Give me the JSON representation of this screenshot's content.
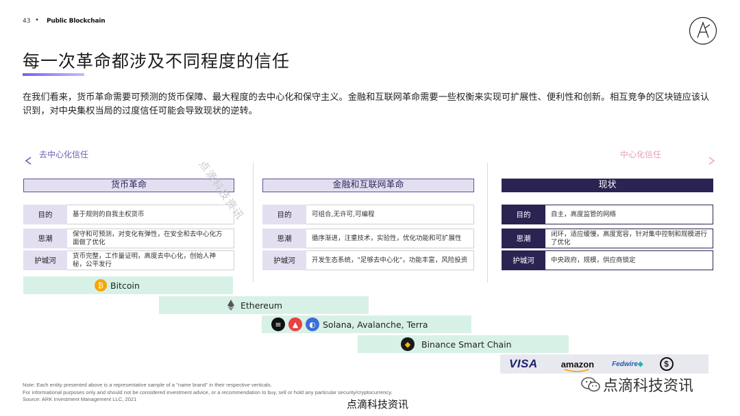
{
  "header": {
    "page_number": "43",
    "separator": "•",
    "section": "Public Blockchain"
  },
  "title": "每一次革命都涉及不同程度的信任",
  "intro": "在我们看来，货币革命需要可预测的货币保障、最大程度的去中心化和保守主义。金融和互联网革命需要一些权衡来实现可扩展性、便利性和创新。相互竞争的区块链应该认识到，对中央集权当局的过度信任可能会导致现状的逆转。",
  "spectrum": {
    "left_label": "去中心化信任",
    "right_label": "中心化信任",
    "colors": {
      "left": "#6b5fb0",
      "right": "#e9a0b4"
    }
  },
  "columns": [
    {
      "title": "货币革命",
      "rows": [
        {
          "label": "目的",
          "value": "基于规则的自我主权货币"
        },
        {
          "label": "思潮",
          "value": "保守和可预测，对变化有弹性，在安全和去中心化方面做了优化"
        },
        {
          "label": "护城河",
          "value": "货币完整，工作量证明，高度去中心化，创始人神秘，公平发行"
        }
      ]
    },
    {
      "title": "金融和互联网革命",
      "rows": [
        {
          "label": "目的",
          "value": "可组合,无许可,可编程"
        },
        {
          "label": "思潮",
          "value": "循序渐进，注重技术，实验性，优化功能和可扩展性"
        },
        {
          "label": "护城河",
          "value": "开发生态系统，\"足够去中心化\"，功能丰富，风险投资"
        }
      ]
    },
    {
      "title": "现状",
      "rows": [
        {
          "label": "目的",
          "value": "自主，高度监管的网络"
        },
        {
          "label": "思潮",
          "value": "闭环，适应缓慢，高度宽容，针对集中控制和规模进行了优化"
        },
        {
          "label": "护城河",
          "value": "中央政府，规模，供应商锁定"
        }
      ]
    }
  ],
  "bars": {
    "bitcoin": {
      "label": "Bitcoin",
      "icons": [
        "bitcoin-icon"
      ]
    },
    "ethereum": {
      "label": "Ethereum",
      "icons": [
        "ethereum-icon"
      ]
    },
    "solana": {
      "label": "Solana, Avalanche, Terra",
      "icons": [
        "solana-icon",
        "avalanche-icon",
        "terra-icon"
      ]
    },
    "binance": {
      "label": "Binance Smart Chain",
      "icons": [
        "binance-icon"
      ]
    },
    "status_quo": {
      "logos": [
        "VISA",
        "amazon",
        "Fedwire",
        "$"
      ]
    },
    "colors": {
      "crypto_bar": "#d8f1e6",
      "status_quo_bar": "#e8e8ef",
      "accent": "#2b2352"
    }
  },
  "note": {
    "line1": "Note: Each entity presented above is a representative sample of a \"name brand\" in their respective verticals.",
    "line2": "For informational purposes only and should not be considered investment advice, or a recommendation to buy, sell or hold any particular security/cryptocurrency.",
    "line3": "Source: ARK Investment Management LLC, 2021"
  },
  "watermarks": {
    "diagonal": "点滴科技资讯",
    "brand": "点滴科技资讯",
    "bottom": "点滴科技资讯"
  }
}
